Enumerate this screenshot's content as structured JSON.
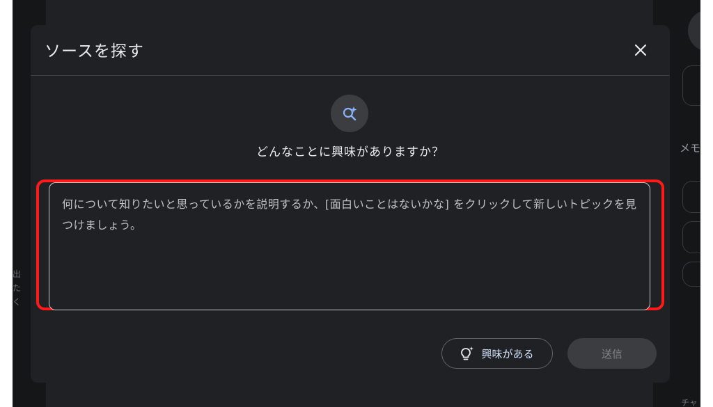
{
  "dialog": {
    "title": "ソースを探す",
    "prompt_heading": "どんなことに興味がありますか？",
    "input_placeholder": "何について知りたいと思っているかを説明するか、[面白いことはないかな] をクリックして新しいトピックを見つけましょう。",
    "interest_button_label": "興味がある",
    "send_button_label": "送信",
    "close_icon": "close-icon",
    "discover_icon": "sparkle-search-icon",
    "interest_icon": "lightbulb-sparkle-icon"
  },
  "background": {
    "right_panel_label": "メモ",
    "left_fragment": "出\nた\nく",
    "bottom_right_fragment": "チャ"
  },
  "colors": {
    "dialog_bg": "#202124",
    "highlight": "#ff1a1a",
    "accent_icon": "#8ab4f8"
  }
}
